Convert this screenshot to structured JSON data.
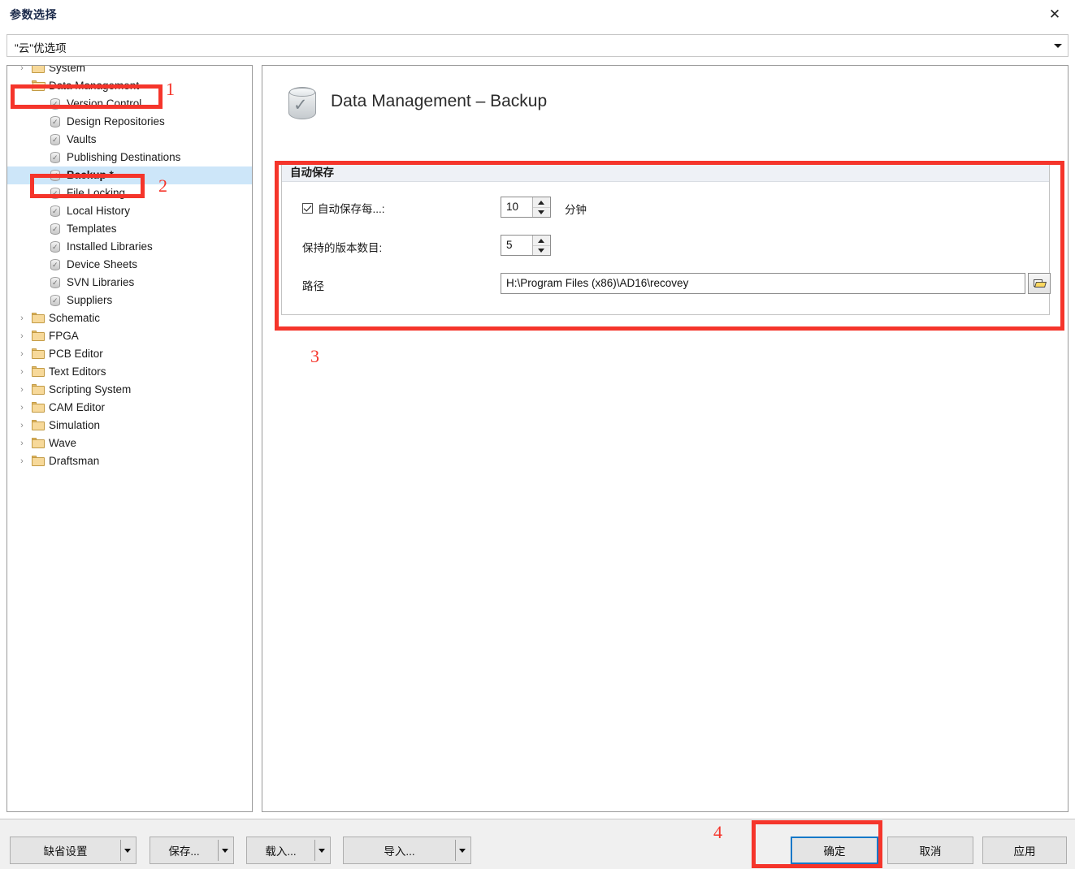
{
  "window": {
    "title": "参数选择",
    "close_label": "✕"
  },
  "preset_combo": {
    "value": "\"云\"优选项",
    "icon": "chevron-down-icon"
  },
  "tree": {
    "items": [
      {
        "label": "System",
        "level": 1,
        "icon": "folder-icon",
        "expander": "›",
        "selected": false,
        "bold": false
      },
      {
        "label": "Data Management",
        "level": 1,
        "icon": "folder-open-icon",
        "expander": "⌄",
        "selected": false,
        "bold": false
      },
      {
        "label": "Version Control",
        "level": 2,
        "icon": "db-check-icon",
        "expander": "",
        "selected": false,
        "bold": false
      },
      {
        "label": "Design Repositories",
        "level": 2,
        "icon": "db-check-icon",
        "expander": "",
        "selected": false,
        "bold": false
      },
      {
        "label": "Vaults",
        "level": 2,
        "icon": "db-check-icon",
        "expander": "",
        "selected": false,
        "bold": false
      },
      {
        "label": "Publishing Destinations",
        "level": 2,
        "icon": "db-check-icon",
        "expander": "",
        "selected": false,
        "bold": false
      },
      {
        "label": "Backup *",
        "level": 2,
        "icon": "db-check-icon",
        "expander": "",
        "selected": true,
        "bold": true
      },
      {
        "label": "File Locking",
        "level": 2,
        "icon": "db-check-icon",
        "expander": "",
        "selected": false,
        "bold": false
      },
      {
        "label": "Local History",
        "level": 2,
        "icon": "db-check-icon",
        "expander": "",
        "selected": false,
        "bold": false
      },
      {
        "label": "Templates",
        "level": 2,
        "icon": "db-check-icon",
        "expander": "",
        "selected": false,
        "bold": false
      },
      {
        "label": "Installed Libraries",
        "level": 2,
        "icon": "db-check-icon",
        "expander": "",
        "selected": false,
        "bold": false
      },
      {
        "label": "Device Sheets",
        "level": 2,
        "icon": "db-check-icon",
        "expander": "",
        "selected": false,
        "bold": false
      },
      {
        "label": "SVN Libraries",
        "level": 2,
        "icon": "db-check-icon",
        "expander": "",
        "selected": false,
        "bold": false
      },
      {
        "label": "Suppliers",
        "level": 2,
        "icon": "db-check-icon",
        "expander": "",
        "selected": false,
        "bold": false
      },
      {
        "label": "Schematic",
        "level": 1,
        "icon": "folder-icon",
        "expander": "›",
        "selected": false,
        "bold": false
      },
      {
        "label": "FPGA",
        "level": 1,
        "icon": "folder-icon",
        "expander": "›",
        "selected": false,
        "bold": false
      },
      {
        "label": "PCB Editor",
        "level": 1,
        "icon": "folder-icon",
        "expander": "›",
        "selected": false,
        "bold": false
      },
      {
        "label": "Text Editors",
        "level": 1,
        "icon": "folder-icon",
        "expander": "›",
        "selected": false,
        "bold": false
      },
      {
        "label": "Scripting System",
        "level": 1,
        "icon": "folder-icon",
        "expander": "›",
        "selected": false,
        "bold": false
      },
      {
        "label": "CAM Editor",
        "level": 1,
        "icon": "folder-icon",
        "expander": "›",
        "selected": false,
        "bold": false
      },
      {
        "label": "Simulation",
        "level": 1,
        "icon": "folder-icon",
        "expander": "›",
        "selected": false,
        "bold": false
      },
      {
        "label": "Wave",
        "level": 1,
        "icon": "folder-icon",
        "expander": "›",
        "selected": false,
        "bold": false
      },
      {
        "label": "Draftsman",
        "level": 1,
        "icon": "folder-icon",
        "expander": "›",
        "selected": false,
        "bold": false
      }
    ]
  },
  "content": {
    "page_title": "Data Management – Backup",
    "page_icon": "db-check-icon",
    "group": {
      "title": "自动保存",
      "autosave": {
        "label": "自动保存每...:",
        "checked": true,
        "value": "10",
        "unit": "分钟"
      },
      "versions": {
        "label": "保持的版本数目:",
        "value": "5"
      },
      "path": {
        "label": "路径",
        "value": "H:\\Program Files (x86)\\AD16\\recovey",
        "browse_icon": "folder-open-icon"
      }
    }
  },
  "footer": {
    "left_buttons": [
      {
        "label": "缺省设置",
        "has_arrow": true
      },
      {
        "label": "保存...",
        "has_arrow": true
      },
      {
        "label": "载入...",
        "has_arrow": true
      },
      {
        "label": "导入...",
        "has_arrow": true
      }
    ],
    "right_buttons": [
      {
        "label": "确定",
        "focused": true
      },
      {
        "label": "取消",
        "focused": false
      },
      {
        "label": "应用",
        "focused": false
      }
    ]
  },
  "annotations": {
    "color": "#f5352b",
    "markers": [
      {
        "num": "1"
      },
      {
        "num": "2"
      },
      {
        "num": "3"
      },
      {
        "num": "4"
      }
    ]
  }
}
